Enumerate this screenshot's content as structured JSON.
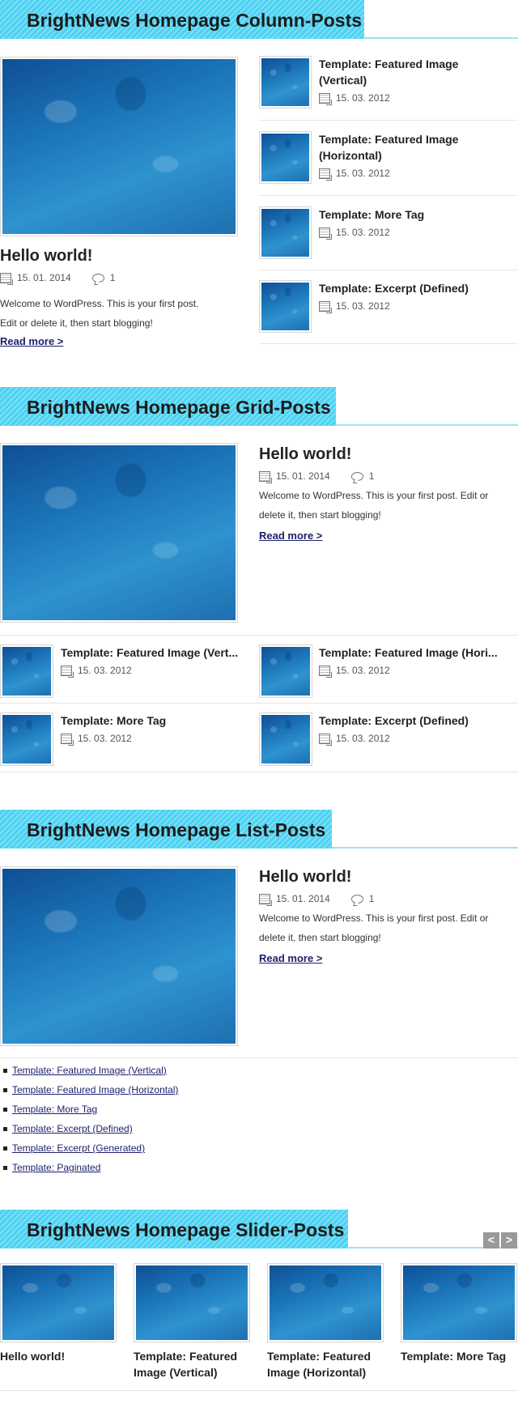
{
  "column_section": {
    "heading": "BrightNews Homepage Column-Posts",
    "featured": {
      "title": "Hello world!",
      "date": "15. 01. 2014",
      "comments": "1",
      "excerpt_line1": "Welcome to WordPress. This is your first post.",
      "excerpt_line2": "Edit or delete it, then start blogging!",
      "read_more": "Read more >"
    },
    "side_posts": [
      {
        "title_line1": "Template: Featured Image",
        "title_line2": "(Vertical)",
        "date": "15. 03. 2012"
      },
      {
        "title_line1": "Template: Featured Image",
        "title_line2": "(Horizontal)",
        "date": "15. 03. 2012"
      },
      {
        "title_line1": "Template: More Tag",
        "title_line2": "",
        "date": "15. 03. 2012"
      },
      {
        "title_line1": "Template: Excerpt (Defined)",
        "title_line2": "",
        "date": "15. 03. 2012"
      }
    ]
  },
  "grid_section": {
    "heading": "BrightNews Homepage Grid-Posts",
    "featured": {
      "title": "Hello world!",
      "date": "15. 01. 2014",
      "comments": "1",
      "excerpt_line1": "Welcome to WordPress. This is your first post. Edit or",
      "excerpt_line2": "delete it, then start blogging!",
      "read_more": "Read more >"
    },
    "grid_posts": [
      {
        "title": "Template: Featured Image (Vert...",
        "date": "15. 03. 2012"
      },
      {
        "title": "Template: Featured Image (Hori...",
        "date": "15. 03. 2012"
      },
      {
        "title": "Template: More Tag",
        "date": "15. 03. 2012"
      },
      {
        "title": "Template: Excerpt (Defined)",
        "date": "15. 03. 2012"
      }
    ]
  },
  "list_section": {
    "heading": "BrightNews Homepage List-Posts",
    "featured": {
      "title": "Hello world!",
      "date": "15. 01. 2014",
      "comments": "1",
      "excerpt_line1": "Welcome to WordPress. This is your first post. Edit or",
      "excerpt_line2": "delete it, then start blogging!",
      "read_more": "Read more >"
    },
    "links": [
      "Template: Featured Image (Vertical)",
      "Template: Featured Image (Horizontal)",
      "Template: More Tag",
      "Template: Excerpt (Defined)",
      "Template: Excerpt (Generated)",
      "Template: Paginated"
    ]
  },
  "slider_section": {
    "heading": "BrightNews Homepage Slider-Posts",
    "prev_label": "<",
    "next_label": ">",
    "slides": [
      {
        "title_line1": "Hello world!",
        "title_line2": ""
      },
      {
        "title_line1": "Template: Featured",
        "title_line2": "Image (Vertical)"
      },
      {
        "title_line1": "Template: Featured",
        "title_line2": "Image (Horizontal)"
      },
      {
        "title_line1": "Template: More Tag",
        "title_line2": ""
      }
    ]
  }
}
